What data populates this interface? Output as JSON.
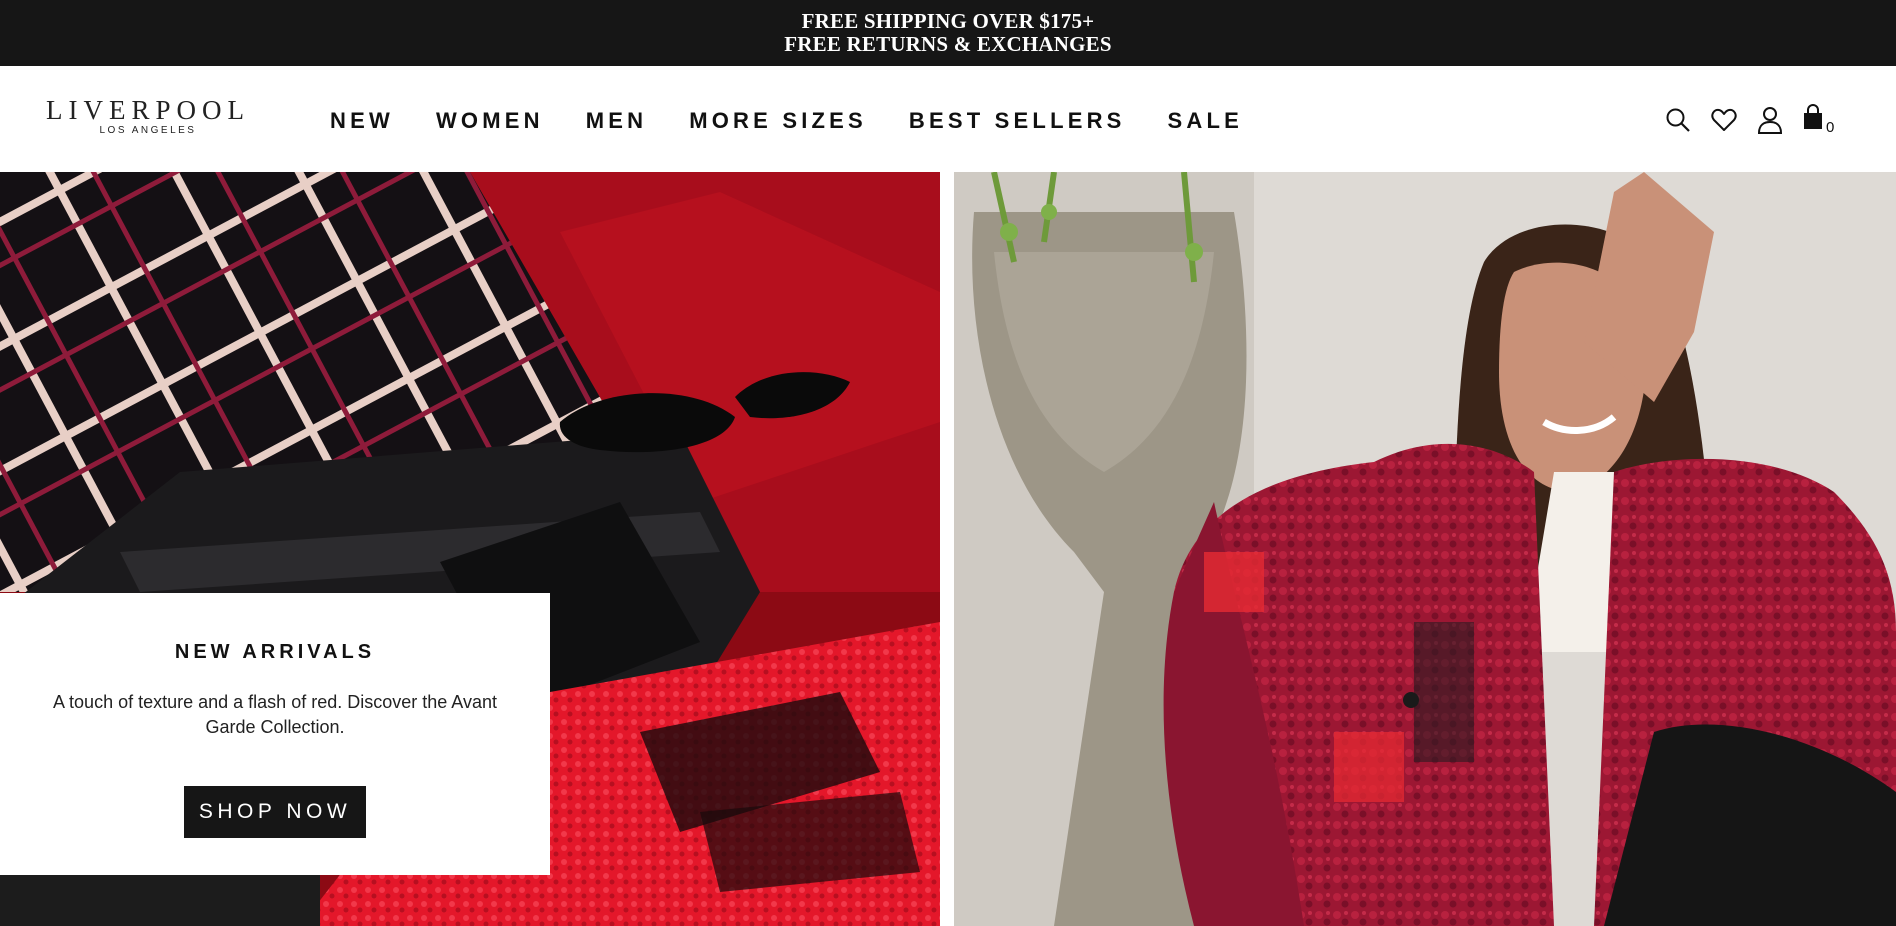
{
  "promo": {
    "line1": "FREE SHIPPING OVER $175+",
    "line2": "FREE RETURNS & EXCHANGES"
  },
  "header": {
    "logo": {
      "brand": "LIVERPOOL",
      "sub": "LOS ANGELES"
    },
    "nav": [
      "NEW",
      "WOMEN",
      "MEN",
      "MORE SIZES",
      "BEST SELLERS",
      "SALE"
    ],
    "icons": [
      "search-icon",
      "heart-icon",
      "user-icon",
      "bag-icon"
    ],
    "bag_count": "0"
  },
  "hero": {
    "left": {
      "card": {
        "title": "NEW ARRIVALS",
        "text": "A touch of texture and a flash of red. Discover the Avant Garde Collection.",
        "button": "SHOP NOW"
      }
    }
  },
  "colors": {
    "promo_bg": "#161616",
    "button_bg": "#161616",
    "accent_red": "#c4101f"
  }
}
